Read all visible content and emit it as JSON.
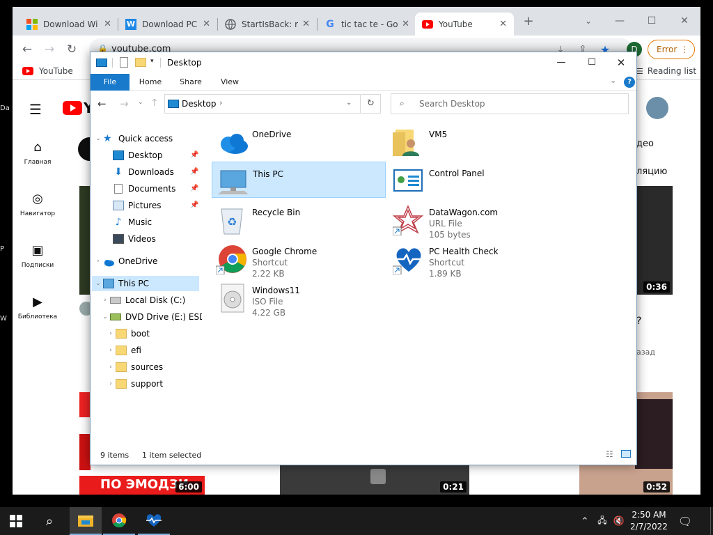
{
  "desktop": {
    "icons": [
      "Da",
      "P",
      "W"
    ]
  },
  "chrome": {
    "tabs": [
      {
        "title": "Download Wi",
        "active": false
      },
      {
        "title": "Download PC",
        "active": false
      },
      {
        "title": "StartIsBack: re",
        "active": false
      },
      {
        "title": "tic tac te - Goo",
        "active": false
      },
      {
        "title": "YouTube",
        "active": true
      }
    ],
    "new_tab": "+",
    "url": "youtube.com",
    "profile_initial": "D",
    "error_label": "Error",
    "bookmark": "YouTube",
    "reading_list": "Reading list"
  },
  "youtube": {
    "logo_text": "Y",
    "sidebar": [
      {
        "label": "Главная",
        "icon": "home-icon"
      },
      {
        "label": "Навигатор",
        "icon": "compass-icon"
      },
      {
        "label": "Подписки",
        "icon": "subscriptions-icon"
      },
      {
        "label": "Библиотека",
        "icon": "library-icon"
      }
    ],
    "right_text1": "део",
    "right_text2": "ляцию",
    "right_q": "?",
    "right_ago": "азад",
    "thumb_text": "ПО ЭМОДЗИ",
    "durations": [
      "0:36",
      "6:00",
      "0:21",
      "0:52"
    ]
  },
  "explorer": {
    "title": "Desktop",
    "ribbon_tabs": [
      "File",
      "Home",
      "Share",
      "View"
    ],
    "address": "Desktop",
    "search_placeholder": "Search Desktop",
    "nav": {
      "quick_access": "Quick access",
      "desktop": "Desktop",
      "downloads": "Downloads",
      "documents": "Documents",
      "pictures": "Pictures",
      "music": "Music",
      "videos": "Videos",
      "onedrive": "OneDrive",
      "this_pc": "This PC",
      "local_disk": "Local Disk (C:)",
      "dvd_drive": "DVD Drive (E:) ESD-I",
      "boot": "boot",
      "efi": "efi",
      "sources": "sources",
      "support": "support"
    },
    "items": [
      {
        "name": "OneDrive",
        "type": "",
        "size": ""
      },
      {
        "name": "VM5",
        "type": "",
        "size": ""
      },
      {
        "name": "This PC",
        "type": "",
        "size": ""
      },
      {
        "name": "Control Panel",
        "type": "",
        "size": ""
      },
      {
        "name": "Recycle Bin",
        "type": "",
        "size": ""
      },
      {
        "name": "DataWagon.com",
        "type": "URL File",
        "size": "105 bytes"
      },
      {
        "name": "Google Chrome",
        "type": "Shortcut",
        "size": "2.22 KB"
      },
      {
        "name": "PC Health Check",
        "type": "Shortcut",
        "size": "1.89 KB"
      },
      {
        "name": "Windows11",
        "type": "ISO File",
        "size": "4.22 GB"
      }
    ],
    "status_count": "9 items",
    "status_selected": "1 item selected"
  },
  "taskbar": {
    "time": "2:50 AM",
    "date": "2/7/2022"
  },
  "colors": {
    "accent": "#1979ca",
    "selection": "#cce8ff",
    "youtube_red": "#ff0000"
  }
}
